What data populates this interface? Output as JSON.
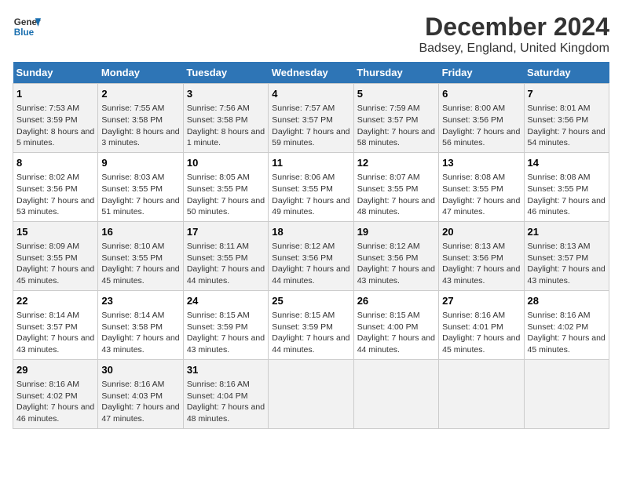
{
  "logo": {
    "line1": "General",
    "line2": "Blue"
  },
  "title": "December 2024",
  "subtitle": "Badsey, England, United Kingdom",
  "days_of_week": [
    "Sunday",
    "Monday",
    "Tuesday",
    "Wednesday",
    "Thursday",
    "Friday",
    "Saturday"
  ],
  "weeks": [
    [
      {
        "day": 1,
        "sunrise": "7:53 AM",
        "sunset": "3:59 PM",
        "daylight": "8 hours and 5 minutes."
      },
      {
        "day": 2,
        "sunrise": "7:55 AM",
        "sunset": "3:58 PM",
        "daylight": "8 hours and 3 minutes."
      },
      {
        "day": 3,
        "sunrise": "7:56 AM",
        "sunset": "3:58 PM",
        "daylight": "8 hours and 1 minute."
      },
      {
        "day": 4,
        "sunrise": "7:57 AM",
        "sunset": "3:57 PM",
        "daylight": "7 hours and 59 minutes."
      },
      {
        "day": 5,
        "sunrise": "7:59 AM",
        "sunset": "3:57 PM",
        "daylight": "7 hours and 58 minutes."
      },
      {
        "day": 6,
        "sunrise": "8:00 AM",
        "sunset": "3:56 PM",
        "daylight": "7 hours and 56 minutes."
      },
      {
        "day": 7,
        "sunrise": "8:01 AM",
        "sunset": "3:56 PM",
        "daylight": "7 hours and 54 minutes."
      }
    ],
    [
      {
        "day": 8,
        "sunrise": "8:02 AM",
        "sunset": "3:56 PM",
        "daylight": "7 hours and 53 minutes."
      },
      {
        "day": 9,
        "sunrise": "8:03 AM",
        "sunset": "3:55 PM",
        "daylight": "7 hours and 51 minutes."
      },
      {
        "day": 10,
        "sunrise": "8:05 AM",
        "sunset": "3:55 PM",
        "daylight": "7 hours and 50 minutes."
      },
      {
        "day": 11,
        "sunrise": "8:06 AM",
        "sunset": "3:55 PM",
        "daylight": "7 hours and 49 minutes."
      },
      {
        "day": 12,
        "sunrise": "8:07 AM",
        "sunset": "3:55 PM",
        "daylight": "7 hours and 48 minutes."
      },
      {
        "day": 13,
        "sunrise": "8:08 AM",
        "sunset": "3:55 PM",
        "daylight": "7 hours and 47 minutes."
      },
      {
        "day": 14,
        "sunrise": "8:08 AM",
        "sunset": "3:55 PM",
        "daylight": "7 hours and 46 minutes."
      }
    ],
    [
      {
        "day": 15,
        "sunrise": "8:09 AM",
        "sunset": "3:55 PM",
        "daylight": "7 hours and 45 minutes."
      },
      {
        "day": 16,
        "sunrise": "8:10 AM",
        "sunset": "3:55 PM",
        "daylight": "7 hours and 45 minutes."
      },
      {
        "day": 17,
        "sunrise": "8:11 AM",
        "sunset": "3:55 PM",
        "daylight": "7 hours and 44 minutes."
      },
      {
        "day": 18,
        "sunrise": "8:12 AM",
        "sunset": "3:56 PM",
        "daylight": "7 hours and 44 minutes."
      },
      {
        "day": 19,
        "sunrise": "8:12 AM",
        "sunset": "3:56 PM",
        "daylight": "7 hours and 43 minutes."
      },
      {
        "day": 20,
        "sunrise": "8:13 AM",
        "sunset": "3:56 PM",
        "daylight": "7 hours and 43 minutes."
      },
      {
        "day": 21,
        "sunrise": "8:13 AM",
        "sunset": "3:57 PM",
        "daylight": "7 hours and 43 minutes."
      }
    ],
    [
      {
        "day": 22,
        "sunrise": "8:14 AM",
        "sunset": "3:57 PM",
        "daylight": "7 hours and 43 minutes."
      },
      {
        "day": 23,
        "sunrise": "8:14 AM",
        "sunset": "3:58 PM",
        "daylight": "7 hours and 43 minutes."
      },
      {
        "day": 24,
        "sunrise": "8:15 AM",
        "sunset": "3:59 PM",
        "daylight": "7 hours and 43 minutes."
      },
      {
        "day": 25,
        "sunrise": "8:15 AM",
        "sunset": "3:59 PM",
        "daylight": "7 hours and 44 minutes."
      },
      {
        "day": 26,
        "sunrise": "8:15 AM",
        "sunset": "4:00 PM",
        "daylight": "7 hours and 44 minutes."
      },
      {
        "day": 27,
        "sunrise": "8:16 AM",
        "sunset": "4:01 PM",
        "daylight": "7 hours and 45 minutes."
      },
      {
        "day": 28,
        "sunrise": "8:16 AM",
        "sunset": "4:02 PM",
        "daylight": "7 hours and 45 minutes."
      }
    ],
    [
      {
        "day": 29,
        "sunrise": "8:16 AM",
        "sunset": "4:02 PM",
        "daylight": "7 hours and 46 minutes."
      },
      {
        "day": 30,
        "sunrise": "8:16 AM",
        "sunset": "4:03 PM",
        "daylight": "7 hours and 47 minutes."
      },
      {
        "day": 31,
        "sunrise": "8:16 AM",
        "sunset": "4:04 PM",
        "daylight": "7 hours and 48 minutes."
      },
      null,
      null,
      null,
      null
    ]
  ]
}
